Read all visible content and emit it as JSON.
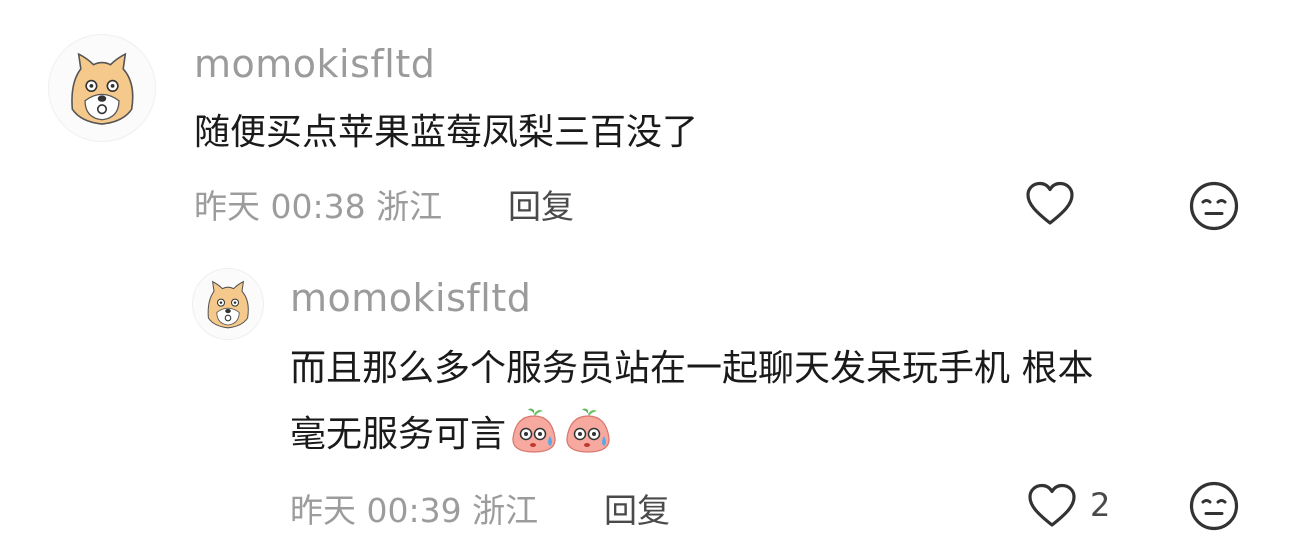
{
  "comments": [
    {
      "username": "momokisfltd",
      "text": "随便买点苹果蓝莓凤梨三百没了",
      "time": "昨天 00:38",
      "location": "浙江",
      "reply_label": "回复",
      "like_count": null
    },
    {
      "username": "momokisfltd",
      "text_line1": "而且那么多个服务员站在一起聊天发呆玩手机 根本",
      "text_line2": "毫无服务可言",
      "time": "昨天 00:39",
      "location": "浙江",
      "reply_label": "回复",
      "like_count": "2"
    }
  ],
  "icons": {
    "like": "heart-outline-icon",
    "dislike": "meh-face-icon",
    "emoji": "sweating-peach-emoji"
  }
}
